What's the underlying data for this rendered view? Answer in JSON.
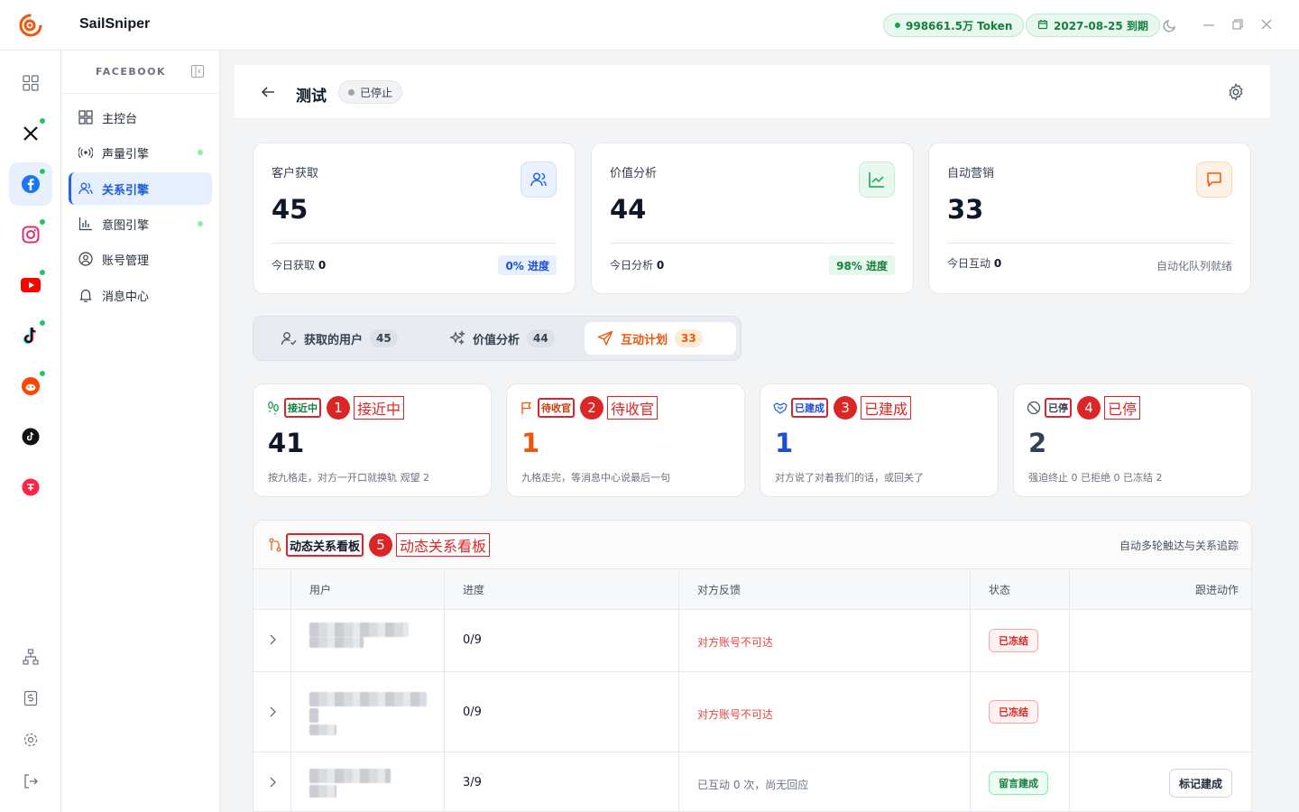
{
  "app": {
    "name": "SailSniper"
  },
  "topbar": {
    "token": "998661.5万 Token",
    "expiry": "2027-08-25 到期"
  },
  "colors": {
    "accent_blue": "#2563eb",
    "accent_orange": "#ea580c",
    "accent_green": "#16a34a",
    "danger_red": "#dc2626"
  },
  "sidebar": {
    "section_title": "FACEBOOK",
    "items": [
      {
        "label": "主控台",
        "icon": "dashboard-icon"
      },
      {
        "label": "声量引擎",
        "icon": "broadcast-icon"
      },
      {
        "label": "关系引擎",
        "icon": "users-icon"
      },
      {
        "label": "意图引擎",
        "icon": "bar-chart-icon"
      },
      {
        "label": "账号管理",
        "icon": "user-circle-icon"
      },
      {
        "label": "消息中心",
        "icon": "bell-icon"
      }
    ]
  },
  "page": {
    "title": "测试",
    "status": "已停止"
  },
  "stats": [
    {
      "label": "客户获取",
      "value": "45",
      "sub_label": "今日获取",
      "sub_value": "0",
      "badge": "0% 进度"
    },
    {
      "label": "价值分析",
      "value": "44",
      "sub_label": "今日分析",
      "sub_value": "0",
      "badge": "98% 进度"
    },
    {
      "label": "自动营销",
      "value": "33",
      "sub_label": "今日互动",
      "sub_value": "0",
      "badge": "自动化队列就绪"
    }
  ],
  "tabs": [
    {
      "label": "获取的用户",
      "count": "45"
    },
    {
      "label": "价值分析",
      "count": "44"
    },
    {
      "label": "互动计划",
      "count": "33"
    }
  ],
  "stages": [
    {
      "tag": "接近中",
      "marker": "1",
      "marker_label": "接近中",
      "count": "41",
      "desc": "按九格走，对方一开口就换轨   观望 2"
    },
    {
      "tag": "待收官",
      "marker": "2",
      "marker_label": "待收官",
      "count": "1",
      "desc": "九格走完，等消息中心说最后一句"
    },
    {
      "tag": "已建成",
      "marker": "3",
      "marker_label": "已建成",
      "count": "1",
      "desc": "对方说了对着我们的话，或回关了"
    },
    {
      "tag": "已停",
      "marker": "4",
      "marker_label": "已停",
      "count": "2",
      "desc": "强迫终止 0   已拒绝 0   已冻结 2"
    }
  ],
  "board": {
    "title": "动态关系看板",
    "marker": "5",
    "marker_label": "动态关系看板",
    "subtitle": "自动多轮触达与关系追踪",
    "columns": [
      "用户",
      "进度",
      "对方反馈",
      "状态",
      "跟进动作"
    ],
    "rows": [
      {
        "progress": "0/9",
        "feedback": "对方账号不可达",
        "status": "已冻结",
        "action": ""
      },
      {
        "progress": "0/9",
        "feedback": "对方账号不可达",
        "status": "已冻结",
        "action": ""
      },
      {
        "progress": "3/9",
        "feedback": "已互动 0 次，尚无回应",
        "status": "留言建成",
        "action": "标记建成"
      }
    ]
  }
}
